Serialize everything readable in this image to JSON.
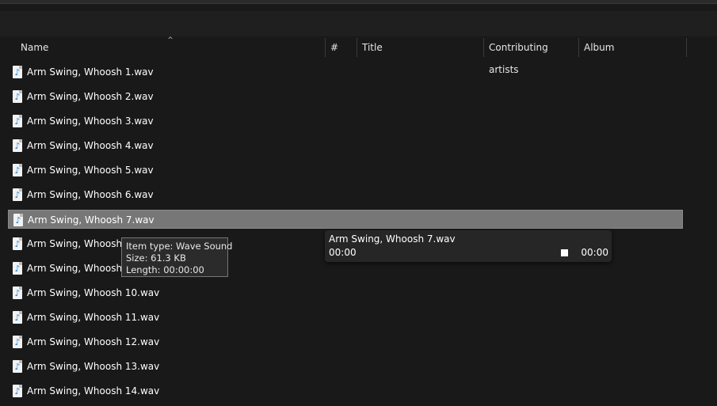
{
  "header": {
    "columns": [
      {
        "label": "Name"
      },
      {
        "label": "#"
      },
      {
        "label": "Title"
      },
      {
        "label": "Contributing artists"
      },
      {
        "label": "Album"
      }
    ],
    "sort_arrow": "^"
  },
  "files": [
    {
      "name": "Arm Swing, Whoosh 1.wav"
    },
    {
      "name": "Arm Swing, Whoosh 2.wav"
    },
    {
      "name": "Arm Swing, Whoosh 3.wav"
    },
    {
      "name": "Arm Swing, Whoosh 4.wav"
    },
    {
      "name": "Arm Swing, Whoosh 5.wav"
    },
    {
      "name": "Arm Swing, Whoosh 6.wav"
    },
    {
      "name": "Arm Swing, Whoosh 7.wav",
      "selected": true
    },
    {
      "name": "Arm Swing, Whoosh 8."
    },
    {
      "name": "Arm Swing, Whoosh 9."
    },
    {
      "name": "Arm Swing, Whoosh 10.wav"
    },
    {
      "name": "Arm Swing, Whoosh 11.wav"
    },
    {
      "name": "Arm Swing, Whoosh 12.wav"
    },
    {
      "name": "Arm Swing, Whoosh 13.wav"
    },
    {
      "name": "Arm Swing, Whoosh 14.wav"
    }
  ],
  "tooltip": {
    "item_type": "Item type: Wave Sound",
    "size": "Size: 61.3 KB",
    "length": "Length: 00:00:00"
  },
  "player": {
    "title": "Arm Swing, Whoosh 7.wav",
    "current_time": "00:00",
    "total_time": "00:00"
  },
  "colors": {
    "background": "#191919",
    "selection": "#777777",
    "icon_accent": "#1b7fd3"
  },
  "icons": {
    "file": "audio-file-icon",
    "stop": "stop-icon"
  }
}
